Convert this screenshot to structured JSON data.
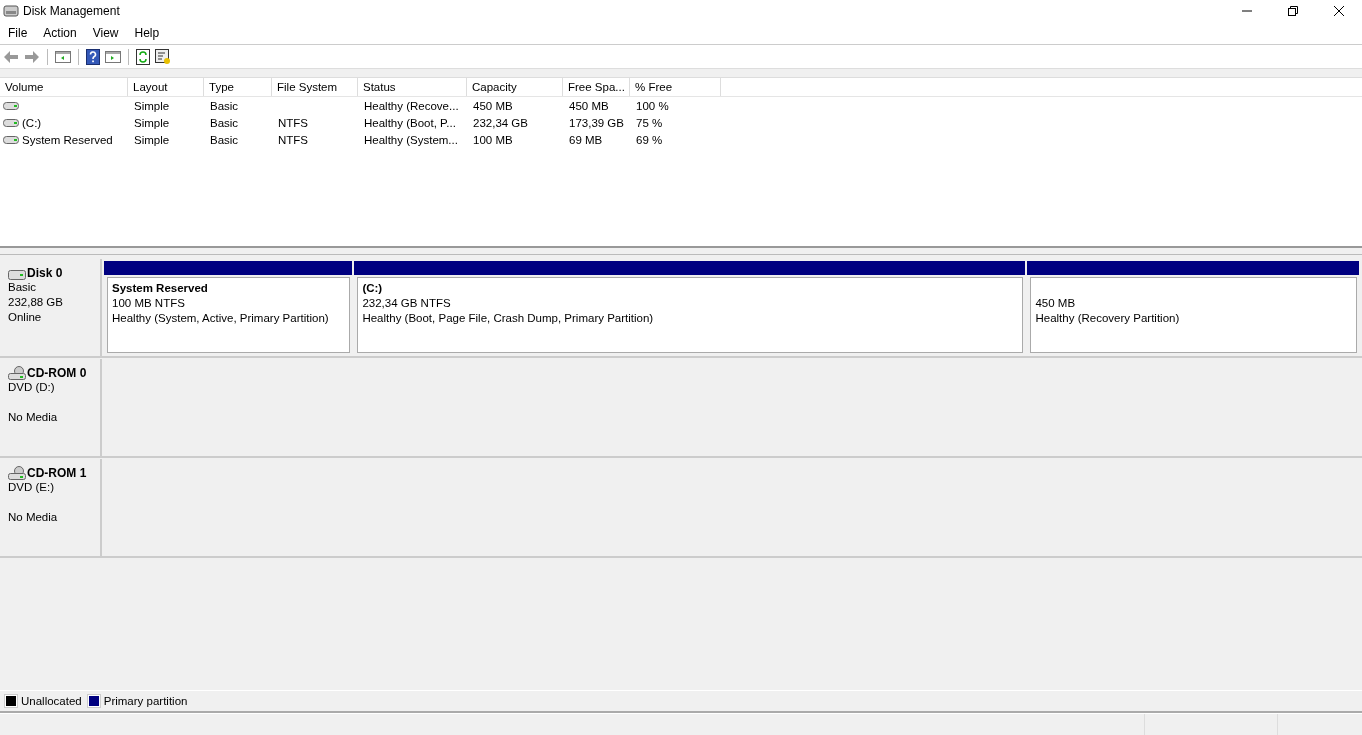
{
  "window": {
    "title": "Disk Management"
  },
  "menu": [
    "File",
    "Action",
    "View",
    "Help"
  ],
  "table": {
    "columns": [
      "Volume",
      "Layout",
      "Type",
      "File System",
      "Status",
      "Capacity",
      "Free Spa...",
      "% Free"
    ],
    "rows": [
      {
        "layout": "Simple",
        "type": "Basic",
        "status": "Healthy (Recove...",
        "capacity": "450 MB",
        "free_space": "450 MB",
        "percent_free": "100 %"
      },
      {
        "volume": "(C:)",
        "layout": "Simple",
        "type": "Basic",
        "file_system": "NTFS",
        "status": "Healthy (Boot, P...",
        "capacity": "232,34 GB",
        "free_space": "173,39 GB",
        "percent_free": "75 %"
      },
      {
        "volume": "System Reserved",
        "layout": "Simple",
        "type": "Basic",
        "file_system": "NTFS",
        "status": "Healthy (System...",
        "capacity": "100 MB",
        "free_space": "69 MB",
        "percent_free": "69 %"
      }
    ]
  },
  "disks": [
    {
      "kind": "disk",
      "name": "Disk 0",
      "lines": [
        "Basic",
        "232,88 GB",
        "Online"
      ],
      "partitions": [
        {
          "name": "System Reserved",
          "size": "100 MB NTFS",
          "status": "Healthy (System, Active, Primary Partition)",
          "color": "#000080"
        },
        {
          "name": "(C:)",
          "size": "232,34 GB NTFS",
          "status": "Healthy (Boot, Page File, Crash Dump, Primary Partition)",
          "color": "#000080"
        },
        {
          "size": "450 MB",
          "status": "Healthy (Recovery Partition)",
          "color": "#000080"
        }
      ]
    },
    {
      "kind": "cdrom",
      "name": "CD-ROM 0",
      "lines": [
        "DVD (D:)"
      ],
      "media": "No Media"
    },
    {
      "kind": "cdrom",
      "name": "CD-ROM 1",
      "lines": [
        "DVD (E:)"
      ],
      "media": "No Media"
    }
  ],
  "legend": [
    {
      "label": "Unallocated",
      "color": "#000000"
    },
    {
      "label": "Primary partition",
      "color": "#000080"
    }
  ]
}
